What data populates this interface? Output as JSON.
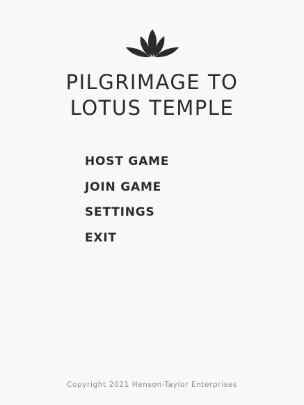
{
  "logo": {
    "icon": "lotus-icon",
    "color": "#2b2b2b"
  },
  "title": {
    "line1": "PILGRIMAGE TO",
    "line2": "LOTUS TEMPLE"
  },
  "menu": {
    "items": [
      {
        "label": "HOST GAME"
      },
      {
        "label": "JOIN GAME"
      },
      {
        "label": "SETTINGS"
      },
      {
        "label": "EXIT"
      }
    ]
  },
  "footer": {
    "copyright": "Copyright 2021 Henson-Taylor Enterprises"
  },
  "colors": {
    "background": "#f8f8f8",
    "text": "#2b2b2b",
    "muted": "#8a8a8a"
  }
}
